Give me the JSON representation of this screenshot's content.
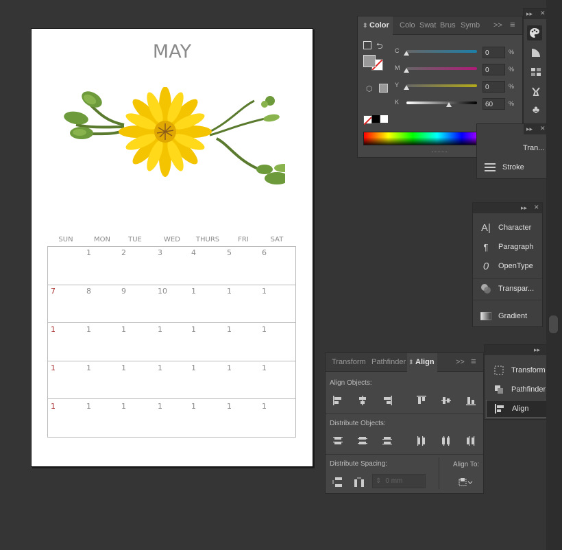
{
  "calendar": {
    "month": "MAY",
    "days": [
      "SUN",
      "MON",
      "TUE",
      "WED",
      "THURS",
      "FRI",
      "SAT"
    ],
    "rows": [
      [
        "",
        "1",
        "2",
        "3",
        "4",
        "5",
        "6"
      ],
      [
        "7",
        "8",
        "9",
        "10",
        "1",
        "1",
        "1"
      ],
      [
        "1",
        "1",
        "1",
        "1",
        "1",
        "1",
        "1"
      ],
      [
        "1",
        "1",
        "1",
        "1",
        "1",
        "1",
        "1"
      ],
      [
        "1",
        "1",
        "1",
        "1",
        "1",
        "1",
        "1"
      ]
    ]
  },
  "color_panel": {
    "tabs": [
      "Color",
      "Colo",
      "Swat",
      "Brus",
      "Symb"
    ],
    "more": ">>",
    "channels": [
      {
        "label": "C",
        "value": "0",
        "unit": "%",
        "level": 0
      },
      {
        "label": "M",
        "value": "0",
        "unit": "%",
        "level": 0
      },
      {
        "label": "Y",
        "value": "0",
        "unit": "%",
        "level": 0
      },
      {
        "label": "K",
        "value": "60",
        "unit": "%",
        "level": 0.6
      }
    ]
  },
  "side_dock_1": {
    "items": [
      {
        "label": "Tran...",
        "icon": "transform-icon"
      },
      {
        "label": "Stroke",
        "icon": "stroke-icon"
      }
    ]
  },
  "side_dock_2": {
    "items": [
      {
        "label": "Character",
        "icon": "character-icon"
      },
      {
        "label": "Paragraph",
        "icon": "paragraph-icon"
      },
      {
        "label": "OpenType",
        "icon": "opentype-icon"
      },
      {
        "label": "Transpar...",
        "icon": "transparency-icon"
      },
      {
        "label": "Gradient",
        "icon": "gradient-icon"
      }
    ]
  },
  "side_dock_3": {
    "items": [
      {
        "label": "Transform",
        "icon": "transform-icon"
      },
      {
        "label": "Pathfinder",
        "icon": "pathfinder-icon"
      },
      {
        "label": "Align",
        "icon": "align-icon"
      }
    ]
  },
  "align_panel": {
    "tabs": [
      "Transform",
      "Pathfinder",
      "Align"
    ],
    "more": ">>",
    "align_objects": "Align Objects:",
    "distribute_objects": "Distribute Objects:",
    "distribute_spacing": "Distribute Spacing:",
    "align_to": "Align To:",
    "spacing_value": "0 mm"
  },
  "colors": {
    "accent_red": "#a33333",
    "flower_yellow": "#f5c400",
    "stem_green": "#5a7a2e"
  }
}
